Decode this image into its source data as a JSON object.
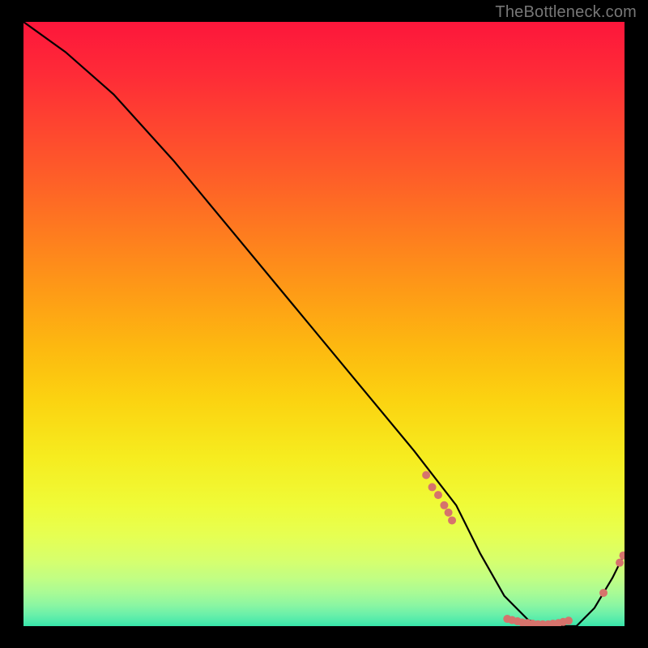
{
  "watermark": "TheBottleneck.com",
  "chart_data": {
    "type": "line",
    "title": "",
    "xlabel": "",
    "ylabel": "",
    "xlim": [
      0,
      100
    ],
    "ylim": [
      0,
      100
    ],
    "grid": false,
    "legend": false,
    "series": [
      {
        "name": "bottleneck-curve",
        "x": [
          0,
          7,
          15,
          25,
          35,
          45,
          55,
          65,
          72,
          76,
          80,
          84,
          88,
          92,
          95,
          98,
          100
        ],
        "y": [
          100,
          95,
          88,
          77,
          65,
          53,
          41,
          29,
          20,
          12,
          5,
          1,
          0,
          0,
          3,
          8,
          12
        ]
      }
    ],
    "markers": {
      "name": "highlight-dots",
      "color": "#d6736c",
      "points": [
        {
          "x": 67,
          "y": 25
        },
        {
          "x": 68,
          "y": 23
        },
        {
          "x": 69,
          "y": 21.7
        },
        {
          "x": 70,
          "y": 20
        },
        {
          "x": 70.7,
          "y": 18.8
        },
        {
          "x": 71.3,
          "y": 17.5
        },
        {
          "x": 80.5,
          "y": 1.2
        },
        {
          "x": 81.3,
          "y": 1.0
        },
        {
          "x": 82.2,
          "y": 0.8
        },
        {
          "x": 83.0,
          "y": 0.6
        },
        {
          "x": 83.9,
          "y": 0.5
        },
        {
          "x": 84.7,
          "y": 0.4
        },
        {
          "x": 85.6,
          "y": 0.3
        },
        {
          "x": 86.4,
          "y": 0.3
        },
        {
          "x": 87.3,
          "y": 0.3
        },
        {
          "x": 88.1,
          "y": 0.4
        },
        {
          "x": 89.0,
          "y": 0.5
        },
        {
          "x": 89.8,
          "y": 0.7
        },
        {
          "x": 90.7,
          "y": 0.9
        },
        {
          "x": 96.5,
          "y": 5.5
        },
        {
          "x": 99.2,
          "y": 10.5
        },
        {
          "x": 99.8,
          "y": 11.7
        }
      ]
    },
    "gradient_stops": [
      {
        "pos": 0.0,
        "color": "#fd163b"
      },
      {
        "pos": 0.09,
        "color": "#fe2c37"
      },
      {
        "pos": 0.18,
        "color": "#fe472f"
      },
      {
        "pos": 0.27,
        "color": "#fe6227"
      },
      {
        "pos": 0.36,
        "color": "#fe7f1e"
      },
      {
        "pos": 0.45,
        "color": "#fe9c16"
      },
      {
        "pos": 0.54,
        "color": "#fdb910"
      },
      {
        "pos": 0.63,
        "color": "#fbd411"
      },
      {
        "pos": 0.72,
        "color": "#f6ec1f"
      },
      {
        "pos": 0.8,
        "color": "#effb38"
      },
      {
        "pos": 0.85,
        "color": "#e6ff52"
      },
      {
        "pos": 0.89,
        "color": "#d7ff6c"
      },
      {
        "pos": 0.92,
        "color": "#c2fe83"
      },
      {
        "pos": 0.945,
        "color": "#a8fb95"
      },
      {
        "pos": 0.965,
        "color": "#8bf6a2"
      },
      {
        "pos": 0.98,
        "color": "#6cf0a9"
      },
      {
        "pos": 0.992,
        "color": "#4feaab"
      },
      {
        "pos": 1.0,
        "color": "#37e4aa"
      }
    ]
  }
}
